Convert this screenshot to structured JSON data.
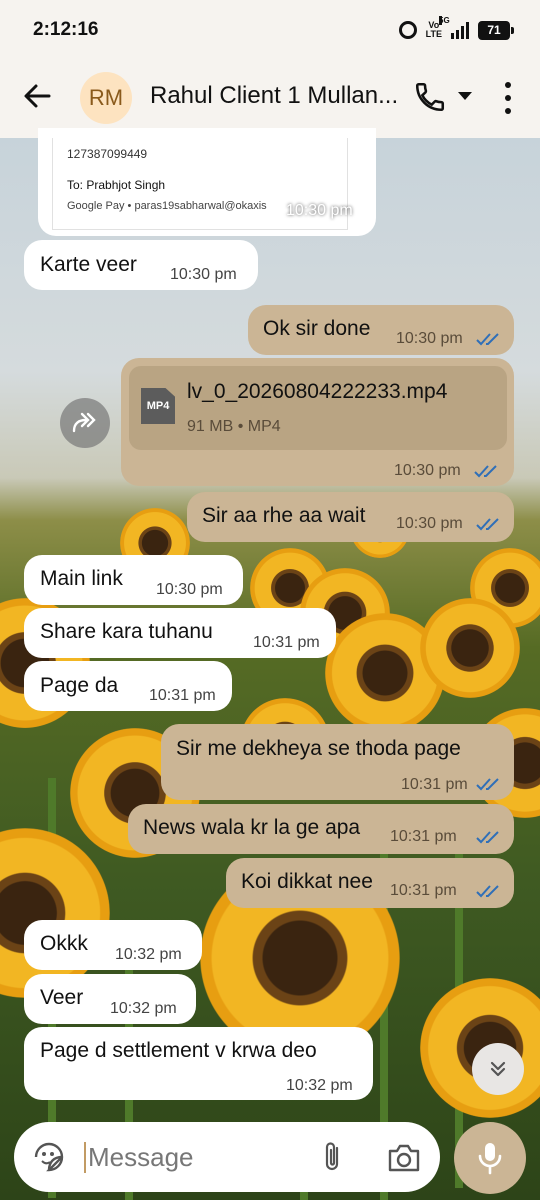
{
  "status_bar": {
    "time": "2:12:16",
    "volte_top": "Vo",
    "volte_bottom": "LTE",
    "network": "5G",
    "battery": "71"
  },
  "header": {
    "avatar_initials": "RM",
    "contact_name": "Rahul Client 1 Mullan...",
    "icons": [
      "back-arrow-icon",
      "phone-icon",
      "caret-down-icon",
      "more-vertical-icon"
    ]
  },
  "payment_card": {
    "account": "127387099449",
    "to": "To: Prabhjot  Singh",
    "via": "Google Pay • paras19sabharwal@okaxis",
    "time": "10:30 pm"
  },
  "messages": [
    {
      "dir": "in",
      "text": "Karte veer",
      "time": "10:30 pm"
    },
    {
      "dir": "out",
      "text": "Ok sir done",
      "time": "10:30 pm",
      "read": true
    },
    {
      "dir": "out",
      "type": "file",
      "file_icon": "MP4",
      "file_name": "lv_0_20260804222233.mp4",
      "file_meta": "91 MB • MP4",
      "time": "10:30 pm",
      "read": true
    },
    {
      "dir": "out",
      "text": "Sir aa rhe aa wait",
      "time": "10:30 pm",
      "read": true
    },
    {
      "dir": "in",
      "text": "Main link",
      "time": "10:30 pm"
    },
    {
      "dir": "in",
      "text": "Share kara tuhanu",
      "time": "10:31 pm"
    },
    {
      "dir": "in",
      "text": "Page da",
      "time": "10:31 pm"
    },
    {
      "dir": "out",
      "text": "Sir me dekheya se thoda page",
      "time": "10:31 pm",
      "read": true
    },
    {
      "dir": "out",
      "text": "News wala kr la ge apa",
      "time": "10:31 pm",
      "read": true
    },
    {
      "dir": "out",
      "text": "Koi dikkat nee",
      "time": "10:31 pm",
      "read": true
    },
    {
      "dir": "in",
      "text": "Okkk",
      "time": "10:32 pm"
    },
    {
      "dir": "in",
      "text": "Veer",
      "time": "10:32 pm"
    },
    {
      "dir": "in",
      "text": "Page d settlement v krwa deo",
      "time": "10:32 pm"
    }
  ],
  "composer": {
    "placeholder": "Message",
    "icons": [
      "sticker-icon",
      "attach-icon",
      "camera-icon",
      "mic-icon"
    ]
  },
  "colors": {
    "outgoing_bubble": "#cbb595",
    "incoming_bubble": "#ffffff",
    "read_ticks": "#2f6fb8",
    "header_bg": "#f6f3ef"
  }
}
